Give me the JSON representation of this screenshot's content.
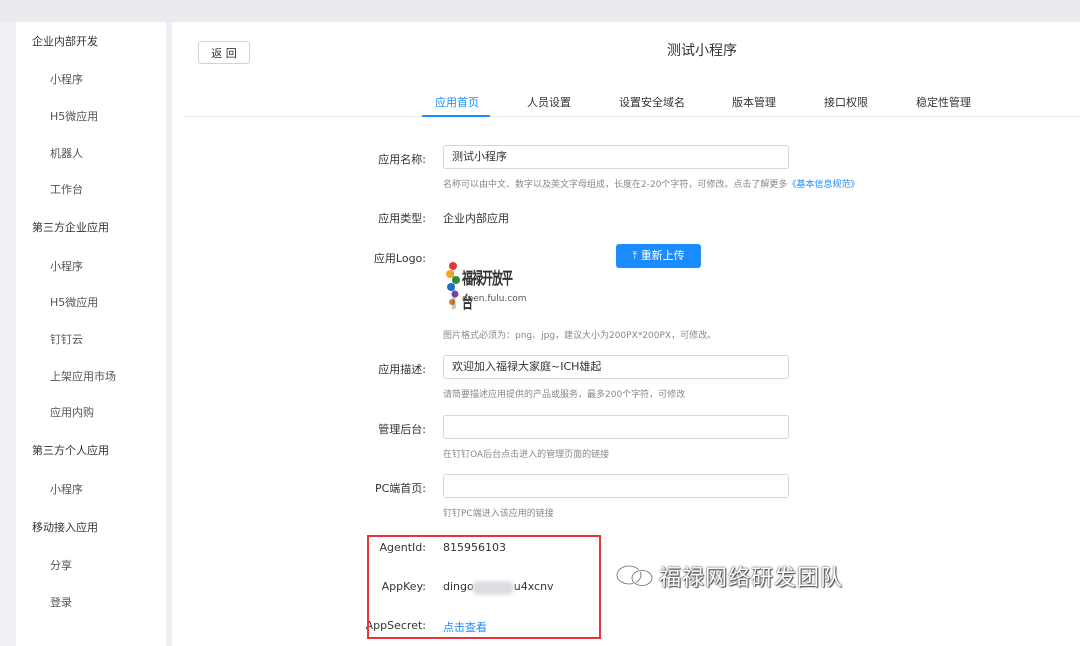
{
  "sidebar": {
    "items": [
      {
        "label": "企业内部开发",
        "kind": "category"
      },
      {
        "label": "小程序",
        "kind": "sub"
      },
      {
        "label": "H5微应用",
        "kind": "sub"
      },
      {
        "label": "机器人",
        "kind": "sub"
      },
      {
        "label": "工作台",
        "kind": "sub"
      },
      {
        "label": "第三方企业应用",
        "kind": "category"
      },
      {
        "label": "小程序",
        "kind": "sub"
      },
      {
        "label": "H5微应用",
        "kind": "sub"
      },
      {
        "label": "钉钉云",
        "kind": "sub"
      },
      {
        "label": "上架应用市场",
        "kind": "sub"
      },
      {
        "label": "应用内购",
        "kind": "sub"
      },
      {
        "label": "第三方个人应用",
        "kind": "category"
      },
      {
        "label": "小程序",
        "kind": "sub"
      },
      {
        "label": "移动接入应用",
        "kind": "category"
      },
      {
        "label": "分享",
        "kind": "sub"
      },
      {
        "label": "登录",
        "kind": "sub"
      }
    ]
  },
  "header": {
    "back_label": "返 回",
    "title": "测试小程序"
  },
  "tabs": [
    {
      "label": "应用首页",
      "active": true
    },
    {
      "label": "人员设置",
      "active": false
    },
    {
      "label": "设置安全域名",
      "active": false
    },
    {
      "label": "版本管理",
      "active": false
    },
    {
      "label": "接口权限",
      "active": false
    },
    {
      "label": "稳定性管理",
      "active": false
    }
  ],
  "form": {
    "app_name": {
      "label": "应用名称:",
      "value": "测试小程序",
      "hint": "名称可以由中文、数字以及英文字母组成，长度在2-20个字符，可修改。点击了解更多",
      "hint_link": "《基本信息规范》"
    },
    "app_type": {
      "label": "应用类型:",
      "value": "企业内部应用"
    },
    "app_logo": {
      "label": "应用Logo:",
      "upload_label": "重新上传",
      "logo_text": "福禄开放平台",
      "logo_url_text": "open.fulu.com",
      "hint": "图片格式必须为：png、jpg，建议大小为200PX*200PX，可修改。"
    },
    "app_desc": {
      "label": "应用描述:",
      "value": "欢迎加入福禄大家庭~ICH雄起",
      "hint": "请简要描述应用提供的产品或服务，最多200个字符，可修改"
    },
    "admin_backend": {
      "label": "管理后台:",
      "value": "",
      "hint": "在钉钉OA后台点击进入的管理页面的链接"
    },
    "pc_home": {
      "label": "PC端首页:",
      "value": "",
      "hint": "钉钉PC端进入该应用的链接"
    },
    "agent_id": {
      "label": "AgentId:",
      "value": "815956103"
    },
    "app_key": {
      "label": "AppKey:",
      "prefix": "dingo",
      "suffix": "u4xcnv"
    },
    "app_secret": {
      "label": "AppSecret:",
      "link": "点击查看"
    }
  },
  "watermark": {
    "text": "福禄网络研发团队",
    "icon": "wechat-icon"
  },
  "colors": {
    "accent": "#1a8cff",
    "highlight": "#e8343a"
  }
}
